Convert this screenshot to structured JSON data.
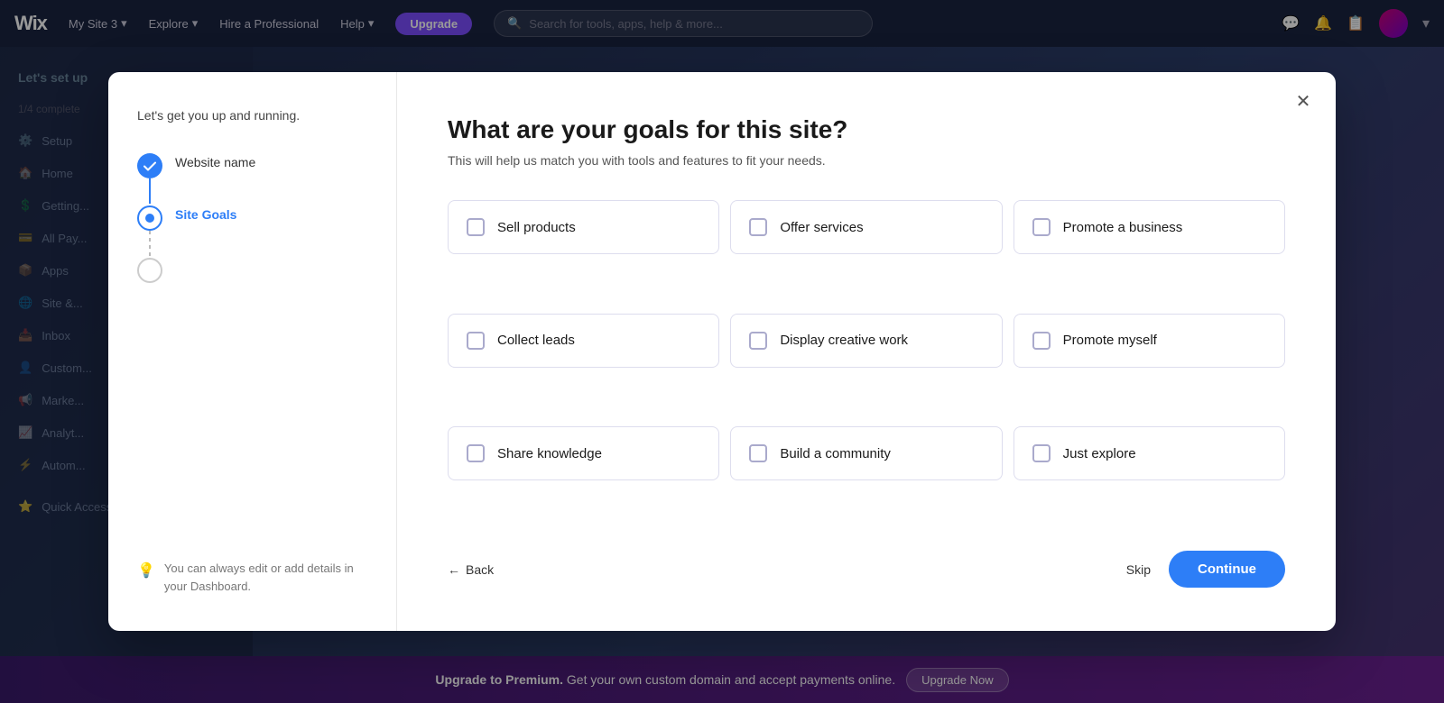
{
  "topnav": {
    "logo": "Wix",
    "site_name": "My Site 3",
    "nav_items": [
      "Explore",
      "Hire a Professional",
      "Help"
    ],
    "upgrade_label": "Upgrade",
    "search_placeholder": "Search for tools, apps, help & more..."
  },
  "sidebar": {
    "top_label": "Let's set up",
    "progress": "1/4 complete",
    "items": [
      {
        "label": "Setup"
      },
      {
        "label": "Home"
      },
      {
        "label": "Getting..."
      },
      {
        "label": "All Pay..."
      },
      {
        "label": "Apps"
      },
      {
        "label": "Site &..."
      },
      {
        "label": "Inbox"
      },
      {
        "label": "Custom..."
      },
      {
        "label": "Marke..."
      },
      {
        "label": "Analyt..."
      },
      {
        "label": "Autom..."
      }
    ],
    "quick_access": "Quick Access"
  },
  "upgrade_bar": {
    "text": "Upgrade to Premium.",
    "sub_text": "Get your own custom domain and accept payments online.",
    "button_label": "Upgrade Now"
  },
  "modal": {
    "close_label": "✕",
    "left": {
      "subtitle": "Let's get you up and running.",
      "steps": [
        {
          "label": "Website name",
          "state": "completed"
        },
        {
          "label": "Site Goals",
          "state": "active"
        },
        {
          "label": "",
          "state": "pending"
        }
      ],
      "tip_icon": "💡",
      "tip_text": "You can always edit or add details in your Dashboard."
    },
    "right": {
      "title": "What are your goals for this site?",
      "description": "This will help us match you with tools and features to fit your needs.",
      "goals": [
        {
          "id": "sell-products",
          "label": "Sell products",
          "checked": false
        },
        {
          "id": "offer-services",
          "label": "Offer services",
          "checked": false
        },
        {
          "id": "promote-business",
          "label": "Promote a business",
          "checked": false
        },
        {
          "id": "collect-leads",
          "label": "Collect leads",
          "checked": false
        },
        {
          "id": "display-creative",
          "label": "Display creative work",
          "checked": false
        },
        {
          "id": "promote-myself",
          "label": "Promote myself",
          "checked": false
        },
        {
          "id": "share-knowledge",
          "label": "Share knowledge",
          "checked": false
        },
        {
          "id": "build-community",
          "label": "Build a community",
          "checked": false
        },
        {
          "id": "just-explore",
          "label": "Just explore",
          "checked": false
        }
      ],
      "footer": {
        "back_label": "Back",
        "skip_label": "Skip",
        "continue_label": "Continue"
      }
    }
  }
}
